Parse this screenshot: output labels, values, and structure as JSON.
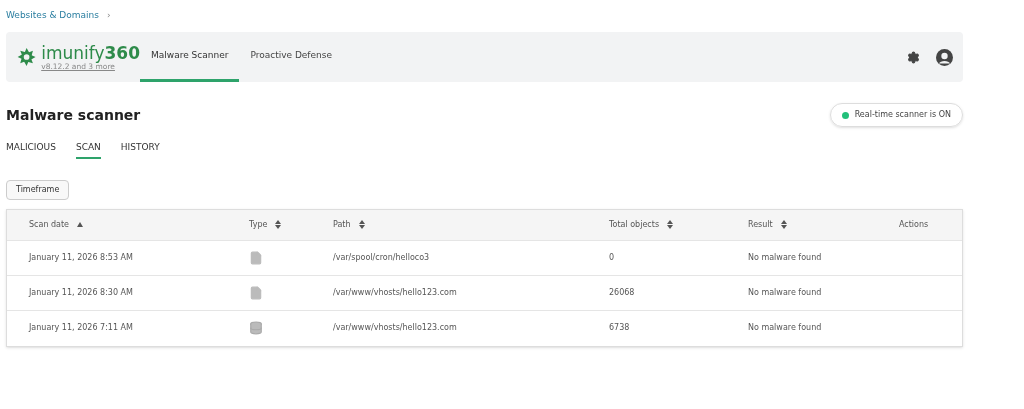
{
  "breadcrumb": {
    "label": "Websites & Domains",
    "separator": "›"
  },
  "header": {
    "logo": {
      "name": "imunify",
      "number": "360",
      "version": "v8.12.2 and 3 more"
    },
    "nav": [
      {
        "label": "Malware Scanner",
        "selected": true
      },
      {
        "label": "Proactive Defense",
        "selected": false
      }
    ]
  },
  "page_title": "Malware scanner",
  "realtime_status": {
    "label": "Real-time scanner is ON",
    "on": true
  },
  "tabs": [
    {
      "label": "MALICIOUS",
      "selected": false
    },
    {
      "label": "SCAN",
      "selected": true
    },
    {
      "label": "HISTORY",
      "selected": false
    }
  ],
  "filter_button": "Timeframe",
  "table": {
    "columns": [
      {
        "label": "Scan date",
        "kind": "ascending"
      },
      {
        "label": "Type",
        "kind": "sortable"
      },
      {
        "label": "Path",
        "kind": "sortable"
      },
      {
        "label": "Total objects",
        "kind": "sortable"
      },
      {
        "label": "Result",
        "kind": "sortable"
      },
      {
        "label": "Actions",
        "kind": "plain"
      }
    ],
    "rows": [
      {
        "scan_date": "January 11, 2026 8:53 AM",
        "kind": "file",
        "path": "/var/spool/cron/helloco3",
        "total_objects": "0",
        "result": "No malware found"
      },
      {
        "scan_date": "January 11, 2026 8:30 AM",
        "kind": "file",
        "path": "/var/www/vhosts/hello123.com",
        "total_objects": "26068",
        "result": "No malware found"
      },
      {
        "scan_date": "January 11, 2026 7:11 AM",
        "kind": "database",
        "path": "/var/www/vhosts/hello123.com",
        "total_objects": "6738",
        "result": "No malware found"
      }
    ]
  }
}
